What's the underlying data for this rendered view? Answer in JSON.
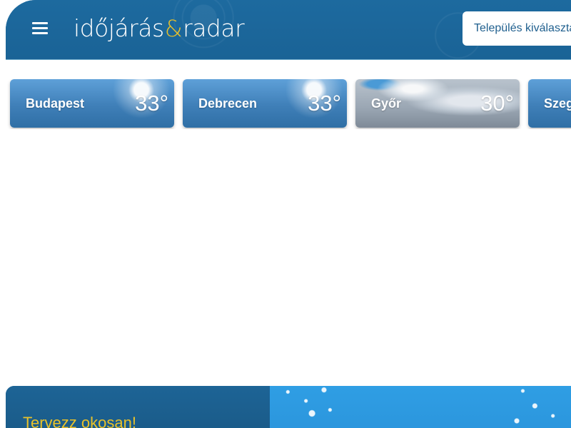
{
  "header": {
    "logo": {
      "part1": "időjárás",
      "amp": "&",
      "part2": "radar"
    },
    "menu_icon": "hamburger-icon",
    "city_select_placeholder": "Település kiválasztása"
  },
  "cities": [
    {
      "name": "Budapest",
      "temp": "33°",
      "condition": "sunny"
    },
    {
      "name": "Debrecen",
      "temp": "33°",
      "condition": "sunny"
    },
    {
      "name": "Győr",
      "temp": "30°",
      "condition": "cloudy"
    },
    {
      "name": "Szeged",
      "temp": "",
      "condition": "sunny"
    }
  ],
  "promo": {
    "title": "Tervezz okosan!"
  },
  "colors": {
    "brand_blue": "#1f6aa0",
    "accent_yellow": "#e8c12a",
    "text_link": "#1f5f8e"
  }
}
